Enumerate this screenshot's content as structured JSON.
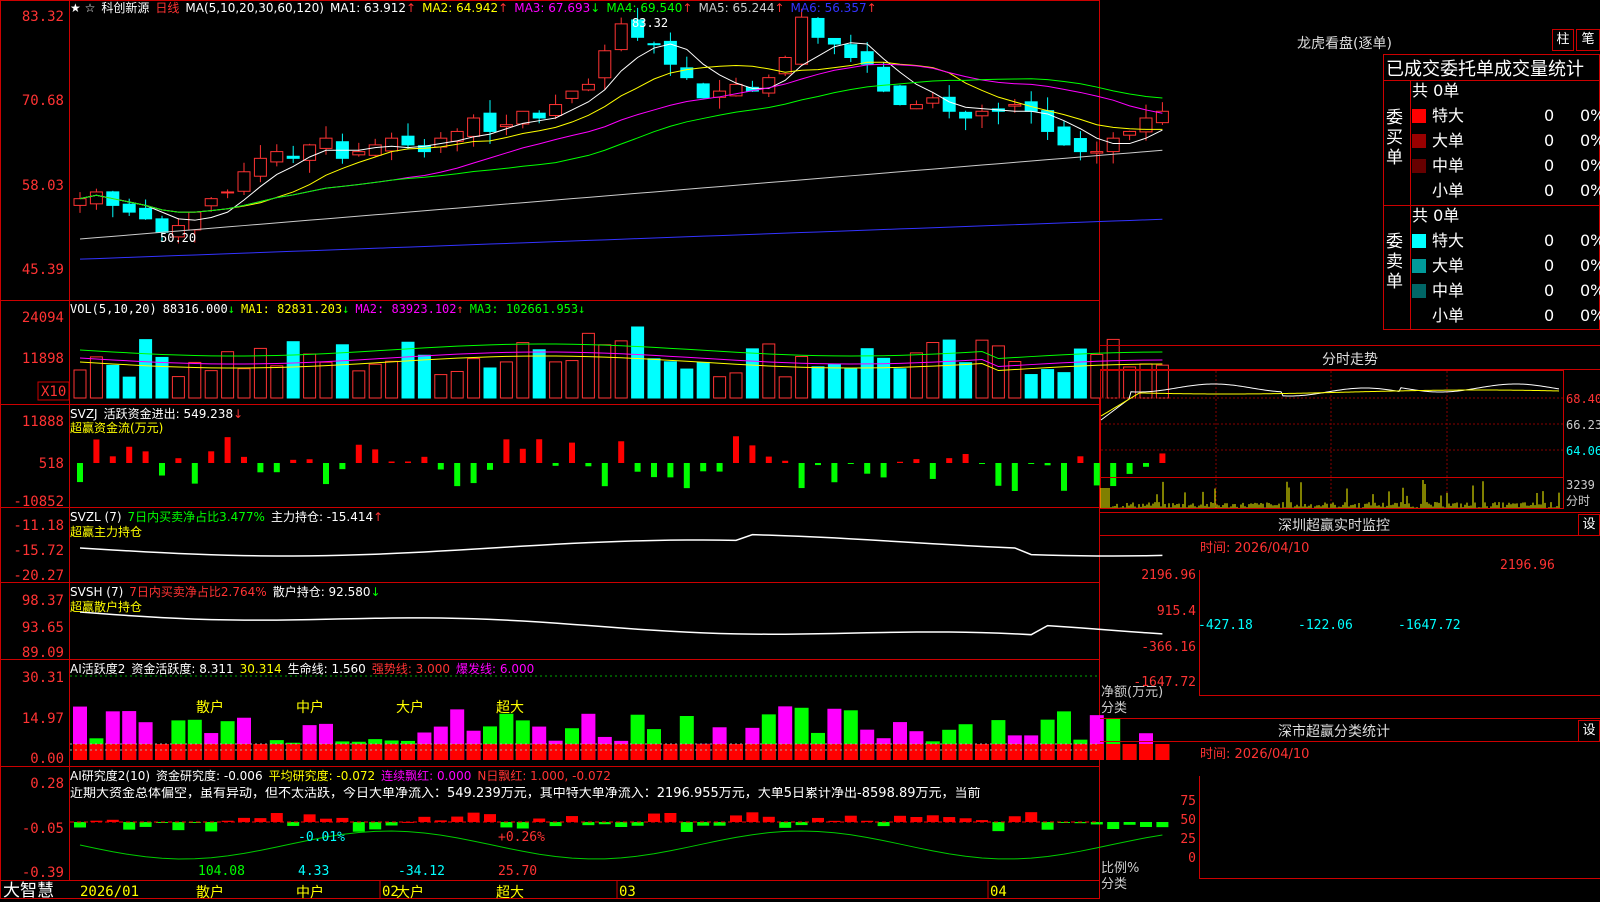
{
  "stock": {
    "name": "科创新源",
    "period": "日线",
    "ma_label": "MA(5,10,20,30,60,120)",
    "ma_values": [
      {
        "label": "MA1: 63.912",
        "arrow": "↑",
        "color": "#ffffff"
      },
      {
        "label": "MA2: 64.942",
        "arrow": "↑",
        "color": "#ffff00"
      },
      {
        "label": "MA3: 67.693",
        "arrow": "↓",
        "color": "#ff00ff"
      },
      {
        "label": "MA4: 69.540",
        "arrow": "↑",
        "color": "#00ff00"
      },
      {
        "label": "MA5: 65.244",
        "arrow": "↑",
        "color": "#cccccc"
      },
      {
        "label": "MA6: 56.357",
        "arrow": "↑",
        "color": "#3333ff"
      }
    ],
    "price_ticks": [
      "83.32",
      "70.68",
      "58.03",
      "45.39"
    ],
    "high_label": "83.32",
    "low_label": "50.20"
  },
  "vol": {
    "header": "VOL(5,10,20)",
    "items": [
      {
        "label": "88316.000",
        "arrow": "↓",
        "color": "#ffffff"
      },
      {
        "label": "MA1: 82831.203",
        "arrow": "↓",
        "color": "#ffff00"
      },
      {
        "label": "MA2: 83923.102",
        "arrow": "↑",
        "color": "#ff00ff"
      },
      {
        "label": "MA3: 102661.953",
        "arrow": "↓",
        "color": "#00ff00"
      }
    ],
    "ticks": [
      "24094",
      "11898"
    ],
    "unit": "X10"
  },
  "svzj": {
    "header": "SVZJ",
    "item": "活跃资金进出: 549.238",
    "arrow": "↓",
    "sub": "超赢资金流(万元)",
    "ticks": [
      "11888",
      "518",
      "-10852"
    ]
  },
  "svzl": {
    "header": "SVZL (7)",
    "item1": "7日内买卖净占比3.477%",
    "item2": "主力持仓: -15.414",
    "arrow": "↑",
    "sub": "超赢主力持仓",
    "ticks": [
      "-11.18",
      "-15.72",
      "-20.27"
    ]
  },
  "svsh": {
    "header": "SVSH (7)",
    "item1": "7日内买卖净占比2.764%",
    "item2": "散户持仓: 92.580",
    "arrow": "↓",
    "sub": "超赢散户持仓",
    "ticks": [
      "98.37",
      "93.65",
      "89.09"
    ]
  },
  "ai1": {
    "header": "AI活跃度2",
    "item1": "资金活跃度: 8.311",
    "item2": "30.314",
    "item3": "生命线: 1.560",
    "item4": "强势线: 3.000",
    "item5": "爆发线: 6.000",
    "ticks": [
      "30.31",
      "14.97",
      "0.00"
    ]
  },
  "ai2": {
    "header": "AI研究度2(10)",
    "item1": "资金研究度: -0.006",
    "item2": "平均研究度: -0.072",
    "item3": "连续飘红: 0.000",
    "item4": "N日飘红: 1.000, -0.072",
    "ticks": [
      "0.28",
      "-0.05",
      "-0.39"
    ],
    "comment": "近期大资金总体偏空，虽有异动，但不太活跃，今日大单净流入：549.239万元，其中特大单净流入：2196.955万元，大单5日累计净出-8598.89万元，当前"
  },
  "xaxis": {
    "labels": [
      "2026/01",
      "02",
      "03",
      "04"
    ],
    "brand": "大智慧"
  },
  "longhu": {
    "title": "龙虎看盘(逐单)",
    "btn1": "柱",
    "btn2": "笔",
    "subtitle": "已成交委托单成交量统计",
    "buy_label": "委买单",
    "sell_label": "委卖单",
    "buy_total": "共 0单",
    "sell_total": "共 0单",
    "buy_rows": [
      {
        "name": "特大",
        "count": "0",
        "pct": "0%",
        "color": "#ff0000"
      },
      {
        "name": "大单",
        "count": "0",
        "pct": "0%",
        "color": "#990000"
      },
      {
        "name": "中单",
        "count": "0",
        "pct": "0%",
        "color": "#660000"
      },
      {
        "name": "小单",
        "count": "0",
        "pct": "0%",
        "color": "#000000"
      }
    ],
    "sell_rows": [
      {
        "name": "特大",
        "count": "0",
        "pct": "0%",
        "color": "#00ffff"
      },
      {
        "name": "大单",
        "count": "0",
        "pct": "0%",
        "color": "#009999"
      },
      {
        "name": "中单",
        "count": "0",
        "pct": "0%",
        "color": "#006666"
      },
      {
        "name": "小单",
        "count": "0",
        "pct": "0%",
        "color": "#000000"
      }
    ]
  },
  "fenshi": {
    "title": "分时走势",
    "ticks": [
      "68.40",
      "66.23",
      "64.06"
    ],
    "vol_tick": "3239",
    "vol_label": "分时"
  },
  "sz_monitor": {
    "title": "深圳超赢实时监控",
    "settings": "设",
    "time": "时间: 2026/04/10",
    "ticks": [
      "2196.96",
      "915.4",
      "-366.16",
      "-1647.72"
    ],
    "ylabel1": "净额(万元)",
    "ylabel2": "分类",
    "categories": [
      "散户",
      "中户",
      "大户",
      "超大"
    ],
    "values": [
      -427.18,
      -122.06,
      -1647.72,
      2196.96
    ],
    "value_labels": [
      "-427.18",
      "-122.06",
      "-1647.72",
      "2196.96"
    ]
  },
  "sz_class": {
    "title": "深市超赢分类统计",
    "settings": "设",
    "time": "时间: 2026/04/10",
    "ticks": [
      "75",
      "50",
      "25",
      "0"
    ],
    "ylabel1": "比例%",
    "ylabel2": "分类",
    "categories": [
      "散户",
      "中户",
      "大户",
      "超大"
    ],
    "values": [
      104.08,
      4.33,
      -34.12,
      25.7
    ],
    "value_labels": [
      "104.08",
      "4.33",
      "-34.12",
      "25.70"
    ],
    "top_labels": [
      "",
      "-0.01%",
      "",
      "+0.26%"
    ]
  },
  "chart_data": {
    "type": "line",
    "title": "科创新源 日线",
    "x": [
      "2026/01",
      "02",
      "03",
      "04"
    ],
    "price_range": [
      45.39,
      83.32
    ],
    "high": 83.32,
    "low": 50.2
  }
}
